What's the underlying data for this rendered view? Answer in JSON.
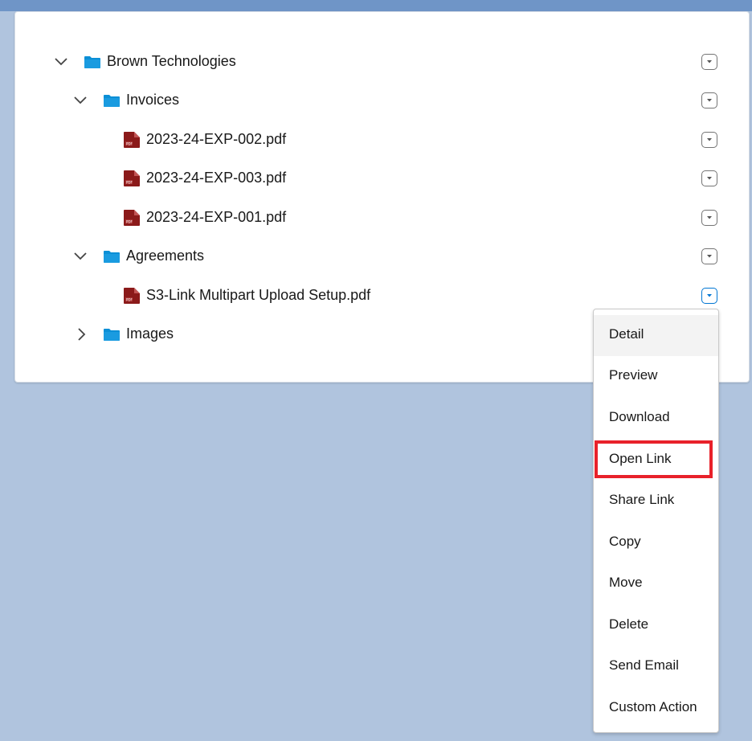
{
  "tree": {
    "items": [
      {
        "label": "Brown Technologies",
        "type": "folder",
        "expanded": true
      },
      {
        "label": "Invoices",
        "type": "folder",
        "expanded": true
      },
      {
        "label": "2023-24-EXP-002.pdf",
        "type": "pdf"
      },
      {
        "label": "2023-24-EXP-003.pdf",
        "type": "pdf"
      },
      {
        "label": "2023-24-EXP-001.pdf",
        "type": "pdf"
      },
      {
        "label": "Agreements",
        "type": "folder",
        "expanded": true
      },
      {
        "label": "S3-Link Multipart Upload Setup.pdf",
        "type": "pdf"
      },
      {
        "label": "Images",
        "type": "folder",
        "expanded": false
      }
    ]
  },
  "context_menu": {
    "items": [
      {
        "label": "Detail"
      },
      {
        "label": "Preview"
      },
      {
        "label": "Download"
      },
      {
        "label": "Open Link"
      },
      {
        "label": "Share Link"
      },
      {
        "label": "Copy"
      },
      {
        "label": "Move"
      },
      {
        "label": "Delete"
      },
      {
        "label": "Send Email"
      },
      {
        "label": "Custom Action"
      }
    ],
    "hovered": "Detail",
    "highlighted": "Open Link"
  },
  "colors": {
    "folder": "#0b8fd6",
    "pdf": "#8b1a1a",
    "highlight": "#e8212a",
    "background": "#b0c4de"
  },
  "icons": {
    "expanded": "chevron-down-icon",
    "collapsed": "chevron-right-icon",
    "folder": "folder-icon",
    "pdf": "pdf-file-icon",
    "row_menu": "dropdown-menu-icon"
  }
}
